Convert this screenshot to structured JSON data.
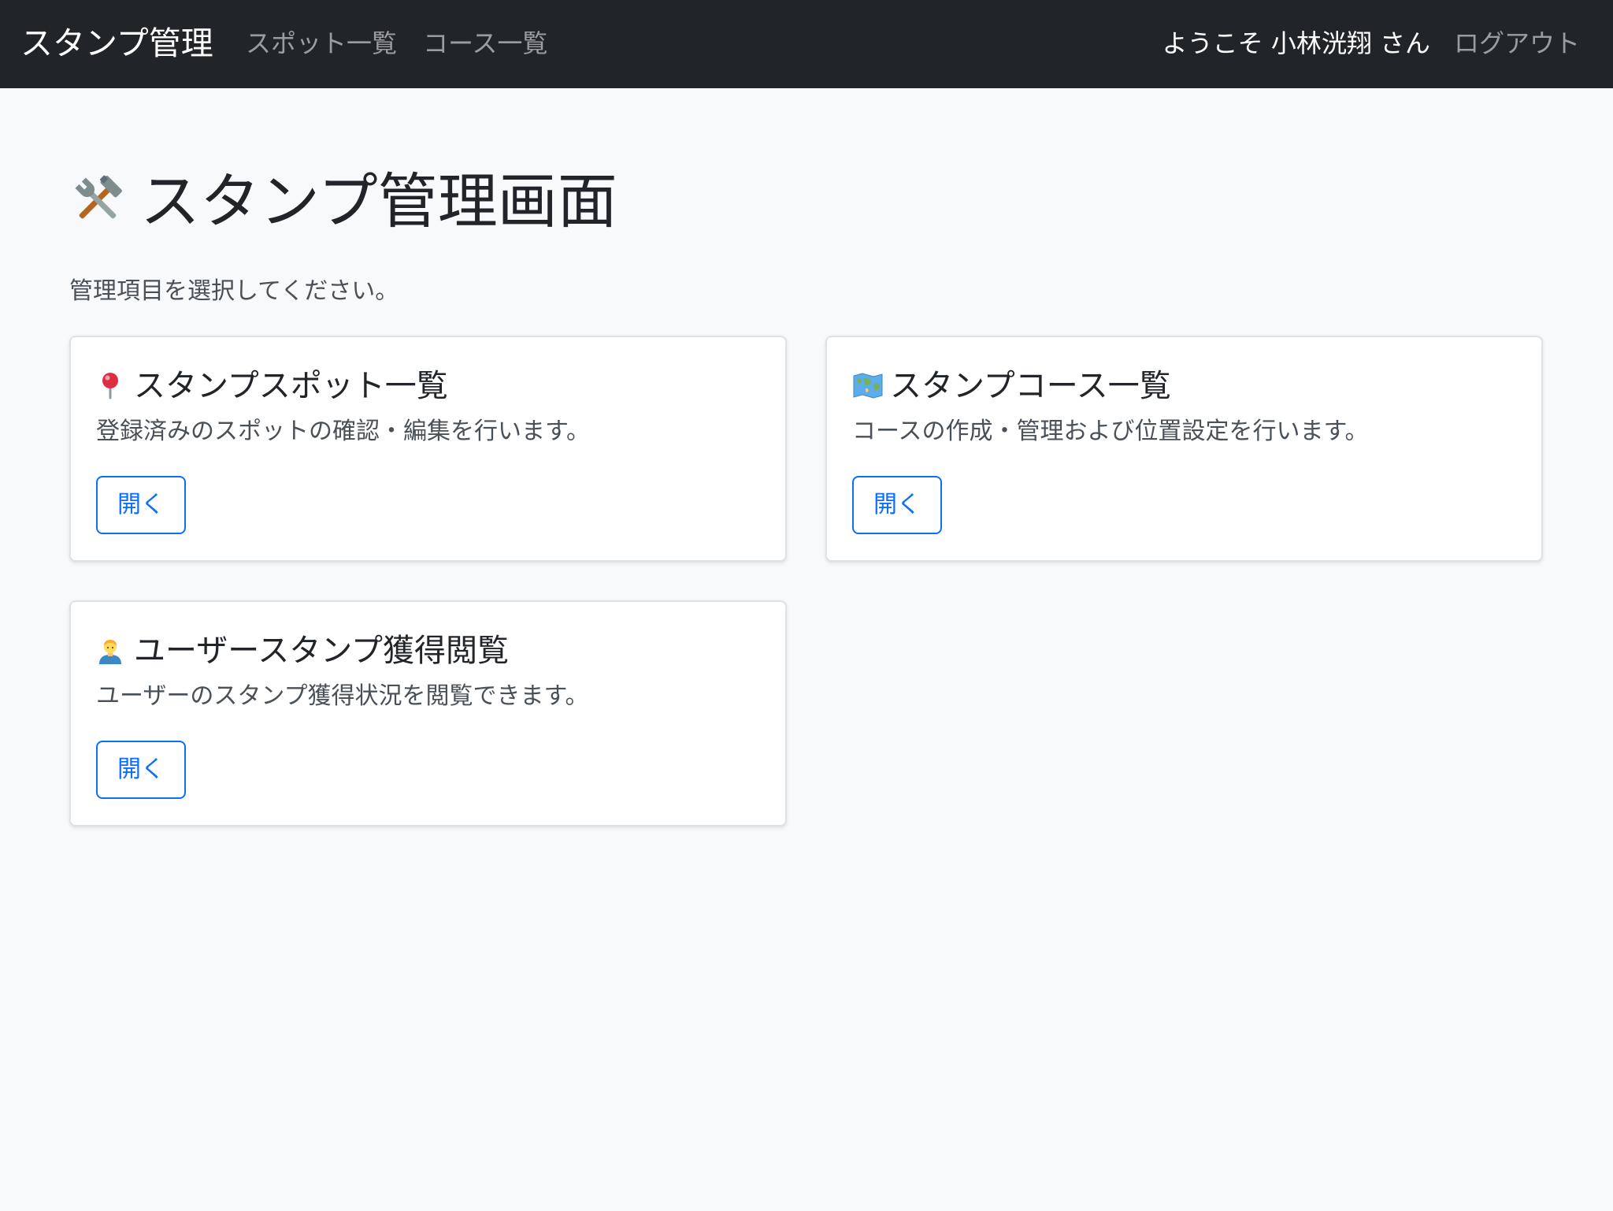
{
  "navbar": {
    "brand": "スタンプ管理",
    "links": [
      "スポット一覧",
      "コース一覧"
    ],
    "welcome": "ようこそ 小林洸翔 さん",
    "logout": "ログアウト"
  },
  "main": {
    "title": "スタンプ管理画面",
    "title_icon": "hammer-and-wrench-icon",
    "subtitle": "管理項目を選択してください。",
    "cards": [
      {
        "icon": "round-pushpin-icon",
        "title": "スタンプスポット一覧",
        "text": "登録済みのスポットの確認・編集を行います。",
        "button": "開く"
      },
      {
        "icon": "world-map-icon",
        "title": "スタンプコース一覧",
        "text": "コースの作成・管理および位置設定を行います。",
        "button": "開く"
      },
      {
        "icon": "user-icon",
        "title": "ユーザースタンプ獲得閲覧",
        "text": "ユーザーのスタンプ獲得状況を閲覧できます。",
        "button": "開く"
      }
    ]
  },
  "colors": {
    "navbar_bg": "#212529",
    "page_bg": "#f8f9fa",
    "primary": "#0d6efd"
  }
}
